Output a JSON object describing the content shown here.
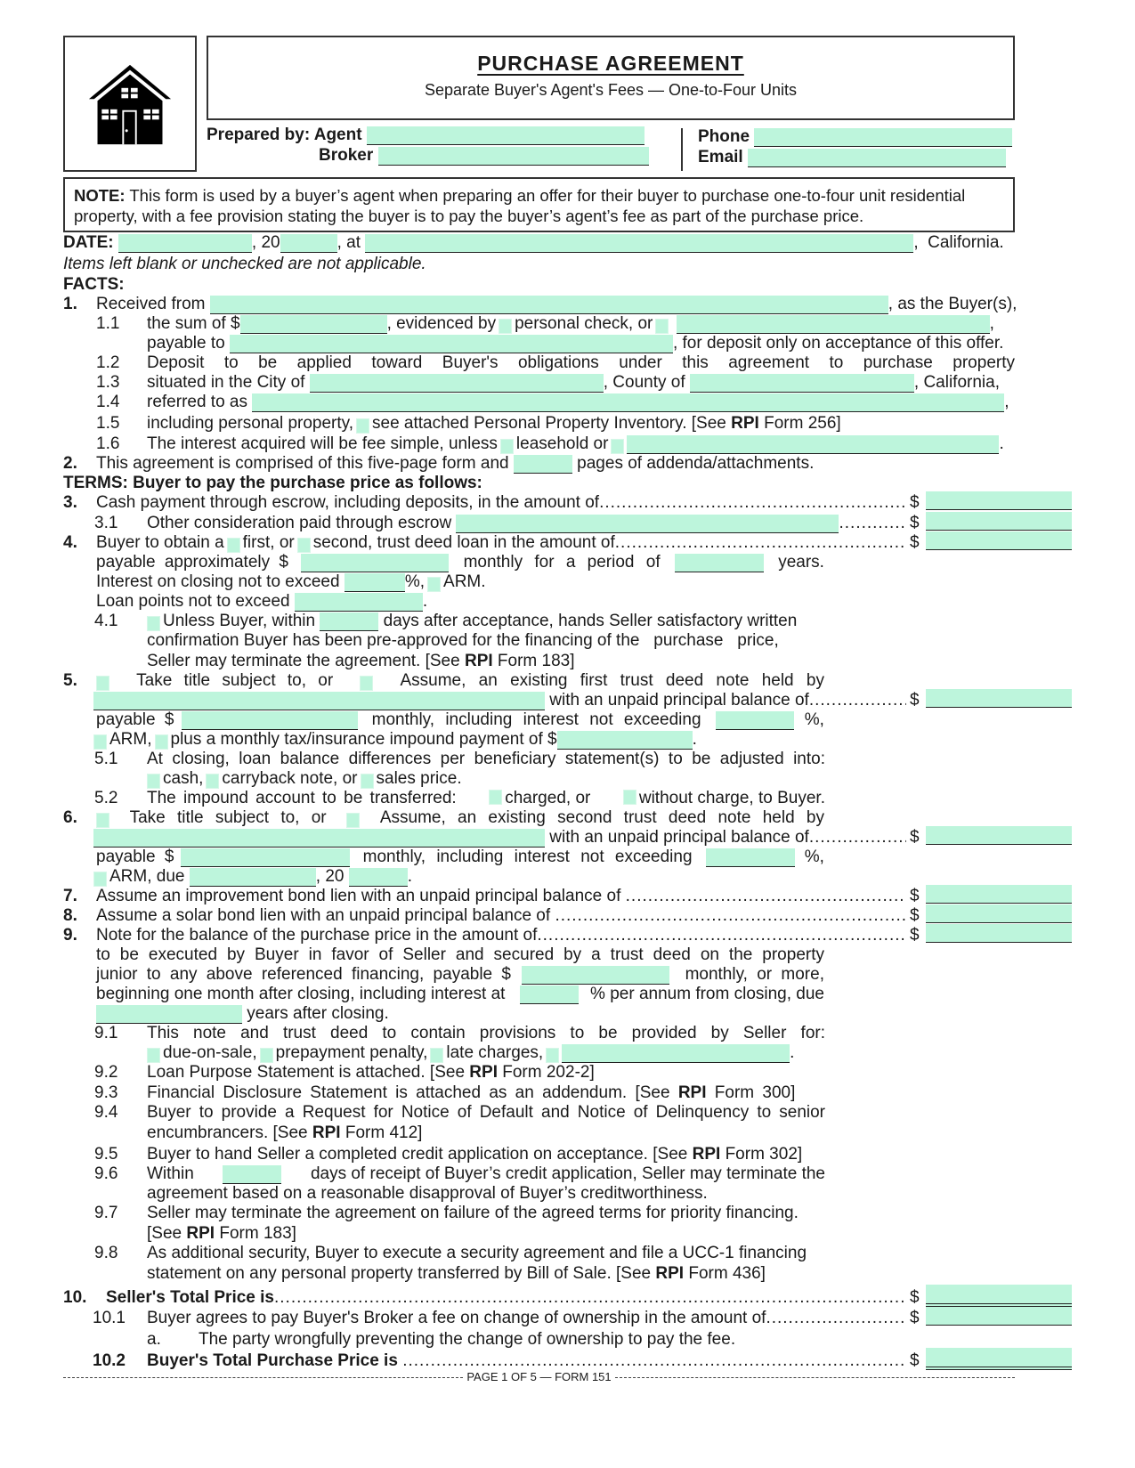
{
  "header": {
    "title": "PURCHASE AGREEMENT",
    "subtitle": "Separate Buyer's Agent's Fees — One-to-Four Units",
    "logo_icon": "house-icon",
    "prepared_by_agent_label": "Prepared by: Agent",
    "broker_label": "Broker",
    "phone_label": "Phone",
    "email_label": "Email"
  },
  "note": {
    "label": "NOTE:",
    "text": " This form is used by a buyer’s agent when preparing an offer for their buyer to purchase one-to-four unit residential property, with a fee provision stating the buyer is to pay the buyer’s agent’s fee as part of the purchase price."
  },
  "date_line": {
    "label": "DATE:",
    "year_prefix": ", 20",
    "at": ", at",
    "state": ",  California."
  },
  "blank_note": "Items left blank or unchecked are not applicable.",
  "facts": {
    "heading": "FACTS:",
    "s1": {
      "num": "1.",
      "pre": "Received from",
      "post": ", as the Buyer(s),"
    },
    "s1_1": {
      "num": "1.1",
      "pre": "the sum of $",
      "mid": ", evidenced by",
      "opt1": "personal check, or",
      "post": ","
    },
    "s1_1b": {
      "pre": "payable to",
      "post": ", for deposit only on acceptance of this offer."
    },
    "s1_2": {
      "num": "1.2",
      "text": "Deposit to be applied toward Buyer's obligations under this agreement to purchase property"
    },
    "s1_3": {
      "num": "1.3",
      "pre": "situated in the City of",
      "mid": ", County of",
      "post": ", California,"
    },
    "s1_4": {
      "num": "1.4",
      "pre": "referred to as",
      "post": ","
    },
    "s1_5": {
      "num": "1.5",
      "pre": "including personal property,",
      "post": "see attached Personal Property Inventory. [See ",
      "rpi": "RPI",
      "form": " Form 256]"
    },
    "s1_6": {
      "num": "1.6",
      "pre": "The interest acquired will be fee simple, unless",
      "opt": "leasehold or",
      "post": "."
    },
    "s2": {
      "num": "2.",
      "pre": "This agreement is comprised of this five-page form and",
      "post": "pages of addenda/attachments."
    }
  },
  "terms": {
    "heading": "TERMS: Buyer to pay the purchase price as follows:",
    "s3": {
      "num": "3.",
      "text": "Cash payment through escrow, including deposits, in the amount of"
    },
    "s3_1": {
      "num": "3.1",
      "text": "Other consideration paid through escrow"
    },
    "s4": {
      "num": "4.",
      "pre": "Buyer to obtain a",
      "opt1": "first, or",
      "opt2": "second, trust deed loan in the amount of"
    },
    "s4b": {
      "pre": "payable approximately $",
      "mid": "monthly for a period of",
      "post": "years."
    },
    "s4c": {
      "pre": "Interest on closing not to exceed",
      "pct": "%,",
      "arm": "ARM."
    },
    "s4d": {
      "pre": "Loan points not to exceed",
      "post": "."
    },
    "s4_1": {
      "num": "4.1",
      "pre": "Unless Buyer, within",
      "post": "days after acceptance, hands Seller satisfactory written",
      "l2": "confirmation Buyer has been pre-approved for the financing of the   purchase   price,",
      "l3a": "Seller may terminate the agreement. [See ",
      "rpi": "RPI",
      "l3b": " Form 183]"
    },
    "s5": {
      "num": "5.",
      "opt1": "Take title subject to, or",
      "opt2": "Assume, an existing first trust deed note held by",
      "l2": "with an unpaid principal balance of",
      "l3pre": "payable $",
      "l3mid": "monthly, including interest not exceeding",
      "l3post": "%,",
      "l4a": "ARM,",
      "l4b": "plus a monthly tax/insurance impound payment of $",
      "l4post": "."
    },
    "s5_1": {
      "num": "5.1",
      "text": "At closing, loan balance differences per beneficiary statement(s) to be adjusted into:",
      "o1": "cash,",
      "o2": "carryback note, or",
      "o3": "sales price."
    },
    "s5_2": {
      "num": "5.2",
      "pre": "The impound account to be transferred:",
      "o1": "charged, or",
      "o2": "without charge, to Buyer."
    },
    "s6": {
      "num": "6.",
      "opt1": "Take title subject to, or",
      "opt2": "Assume, an existing second trust deed note held by",
      "l2": "with an unpaid principal balance of",
      "l3pre": "payable $",
      "l3mid": "monthly, including interest not exceeding",
      "l3post": "%,",
      "l4a": "ARM, due",
      "l4b": ", 20",
      "l4post": "."
    },
    "s7": {
      "num": "7.",
      "text": "Assume an improvement bond lien with an unpaid principal balance of"
    },
    "s8": {
      "num": "8.",
      "text": "Assume a solar bond lien with an unpaid principal balance of"
    },
    "s9": {
      "num": "9.",
      "text": "Note for the balance of the purchase price in the amount of",
      "l2": "to be executed by Buyer in favor of Seller and secured by a trust deed on the property",
      "l3pre": "junior to any above referenced financing, payable $",
      "l3post": "monthly, or more,",
      "l4pre": "beginning one month after closing, including interest at",
      "l4post": "% per annum from closing, due",
      "l5": "years after closing."
    },
    "s9_1": {
      "num": "9.1",
      "text": "This note and trust deed to contain provisions to be provided by Seller for:",
      "o1": "due-on-sale,",
      "o2": "prepayment penalty,",
      "o3": "late charges,",
      "post": "."
    },
    "s9_2": {
      "num": "9.2",
      "pre": "Loan Purpose Statement is attached. [See ",
      "rpi": "RPI",
      "post": " Form 202-2]"
    },
    "s9_3": {
      "num": "9.3",
      "pre": "Financial Disclosure Statement is attached as an addendum. [See ",
      "rpi": "RPI",
      "post": " Form 300]"
    },
    "s9_4": {
      "num": "9.4",
      "l1": "Buyer to provide a Request for Notice of Default and Notice of Delinquency to senior",
      "l2pre": "encumbrancers. [See ",
      "rpi": "RPI",
      "l2post": " Form 412]"
    },
    "s9_5": {
      "num": "9.5",
      "pre": "Buyer to hand Seller a completed credit application on acceptance. [See ",
      "rpi": "RPI",
      "post": " Form 302]"
    },
    "s9_6": {
      "num": "9.6",
      "pre": "Within",
      "post": "days of receipt of Buyer’s credit application, Seller may terminate the",
      "l2": "agreement based on a reasonable disapproval of Buyer’s creditworthiness."
    },
    "s9_7": {
      "num": "9.7",
      "l1": "Seller may terminate the agreement on failure of the agreed terms for priority financing.",
      "l2pre": "[See ",
      "rpi": "RPI",
      "l2post": " Form 183]"
    },
    "s9_8": {
      "num": "9.8",
      "l1": "As additional security, Buyer to execute a security agreement and file a UCC-1 financing",
      "l2pre": "statement on any personal property transferred by Bill of Sale. [See ",
      "rpi": "RPI",
      "l2post": " Form 436]"
    },
    "s10": {
      "num": "10.",
      "text": "Seller's Total Price is"
    },
    "s10_1": {
      "num": "10.1",
      "text": "Buyer agrees to pay Buyer's Broker a fee on change of ownership in the amount of"
    },
    "s10_1a": {
      "num": "a.",
      "text": "The party wrongfully preventing the change of ownership to pay the fee."
    },
    "s10_2": {
      "num": "10.2",
      "text": "Buyer's Total Purchase Price is"
    },
    "currency": "$"
  },
  "footer": {
    "text": "PAGE 1 OF 5 — FORM 151"
  },
  "colors": {
    "field_fill": "#bdf5dc",
    "border": "#333333"
  }
}
